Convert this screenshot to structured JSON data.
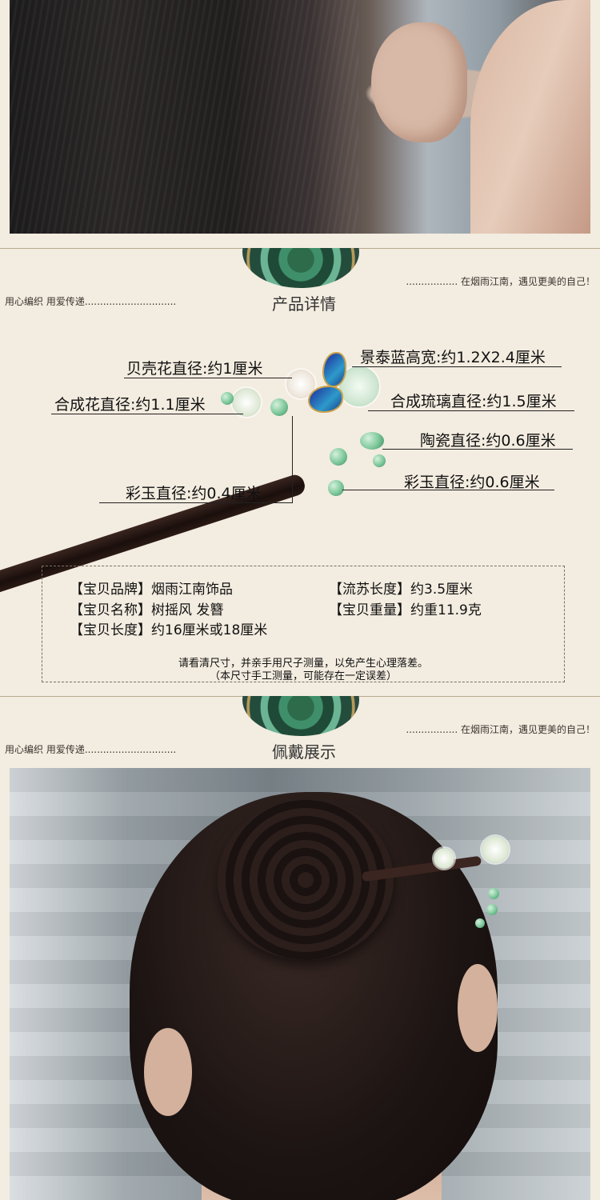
{
  "sections": {
    "details": {
      "left_tagline": "用心编织 用爱传递..............................",
      "right_tagline": "................. 在烟雨江南，遇见更美的自己！",
      "title": "产品详情"
    },
    "wear": {
      "left_tagline": "用心编织 用爱传递..............................",
      "right_tagline": "................. 在烟雨江南，遇见更美的自己！",
      "title": "佩戴展示"
    }
  },
  "annotations": {
    "shell_flower": "贝壳花直径:约1厘米",
    "cloisonne": "景泰蓝高宽:约1.2X2.4厘米",
    "synthetic_flower": "合成花直径:约1.1厘米",
    "synthetic_glass": "合成琉璃直径:约1.5厘米",
    "ceramic": "陶瓷直径:约0.6厘米",
    "colored_jade_right": "彩玉直径:约0.6厘米",
    "colored_jade_left": "彩玉直径:约0.4厘米"
  },
  "specs": {
    "brand": "【宝贝品牌】烟雨江南饰品",
    "name": "【宝贝名称】树摇风 发簪",
    "length": "【宝贝长度】约16厘米或18厘米",
    "tassel": "【流苏长度】约3.5厘米",
    "weight": "【宝贝重量】约重11.9克",
    "note1": "请看清尺寸，并亲手用尺子测量，以免产生心理落差。",
    "note2": "（本尺寸手工测量，可能存在一定误差）"
  },
  "colors": {
    "background": "#f3ece0",
    "medallion_green": "#2d6b4b",
    "cloisonne_blue": "#1c2a9a",
    "jade_green": "#7cc79a"
  }
}
